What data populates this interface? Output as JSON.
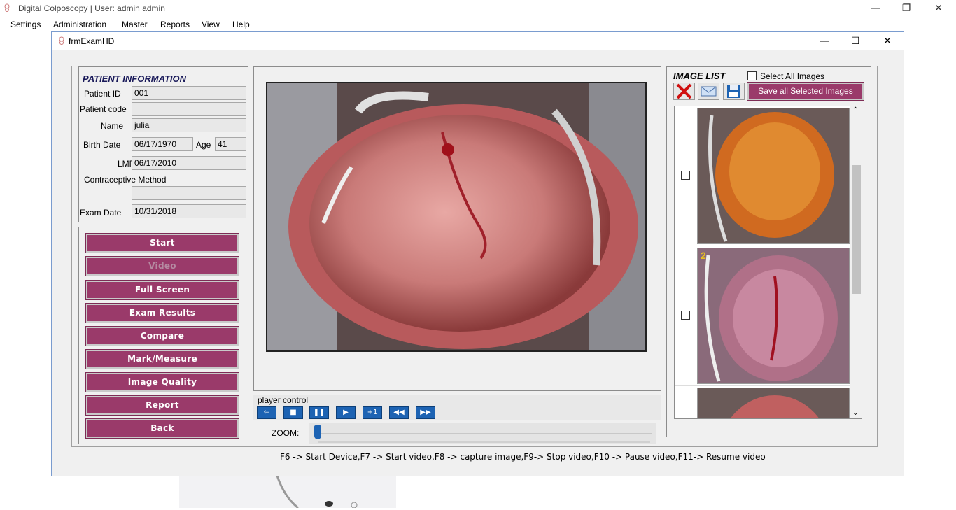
{
  "app": {
    "title": "Digital Colposcopy  |  User:  admin  admin",
    "minimize": "—",
    "restore": "❐",
    "close": "✕"
  },
  "menu": [
    "Settings",
    "Administration",
    "Master",
    "Reports",
    "View",
    "Help"
  ],
  "child": {
    "title": "frmExamHD",
    "minimize": "—",
    "maximize": "☐",
    "close": "✕"
  },
  "patient": {
    "heading": "PATIENT INFORMATION",
    "id_label": "Patient ID",
    "id_value": "001",
    "code_label": "Patient code",
    "code_value": "",
    "name_label": "Name",
    "name_value": "julia",
    "birth_label": "Birth Date",
    "birth_value": "06/17/1970",
    "age_label": "Age",
    "age_value": "41",
    "lmp_label": "LMP",
    "lmp_value": "06/17/2010",
    "contraceptive_label": "Contraceptive Method",
    "contraceptive_value": "",
    "exam_label": "Exam Date",
    "exam_value": "10/31/2018"
  },
  "actions": [
    {
      "label": "Start",
      "enabled": true
    },
    {
      "label": "Video",
      "enabled": false
    },
    {
      "label": "Full Screen",
      "enabled": true
    },
    {
      "label": "Exam Results",
      "enabled": true
    },
    {
      "label": "Compare",
      "enabled": true
    },
    {
      "label": "Mark/Measure",
      "enabled": true
    },
    {
      "label": "Image Quality",
      "enabled": true
    },
    {
      "label": "Report",
      "enabled": true
    },
    {
      "label": "Back",
      "enabled": true
    }
  ],
  "player": {
    "label": "player control",
    "buttons": [
      {
        "icon": "back-arrow-icon",
        "glyph": "⇦"
      },
      {
        "icon": "stop-icon",
        "glyph": "■"
      },
      {
        "icon": "pause-icon",
        "glyph": "❚❚"
      },
      {
        "icon": "play-icon",
        "glyph": "▶"
      },
      {
        "icon": "plus-one-icon",
        "glyph": "+1"
      },
      {
        "icon": "rewind-icon",
        "glyph": "◀◀"
      },
      {
        "icon": "fast-forward-icon",
        "glyph": "▶▶"
      }
    ],
    "zoom_label": "ZOOM:",
    "zoom_level": 0
  },
  "image_list": {
    "heading": "IMAGE LIST",
    "select_all_label": "Select All Images",
    "save_all_label": "Save all Selected Images",
    "thumbnails": [
      {
        "number": "",
        "checked": false
      },
      {
        "number": "2",
        "checked": false
      },
      {
        "number": "",
        "checked": false
      }
    ]
  },
  "shortcuts": "F6 -> Start Device,F7 -> Start video,F8 -> capture image,F9-> Stop video,F10 -> Pause video,F11-> Resume video",
  "colors": {
    "button_bg": "#9a3a6a",
    "player_button": "#1d63b3",
    "accent_border": "#7a9ccf"
  }
}
